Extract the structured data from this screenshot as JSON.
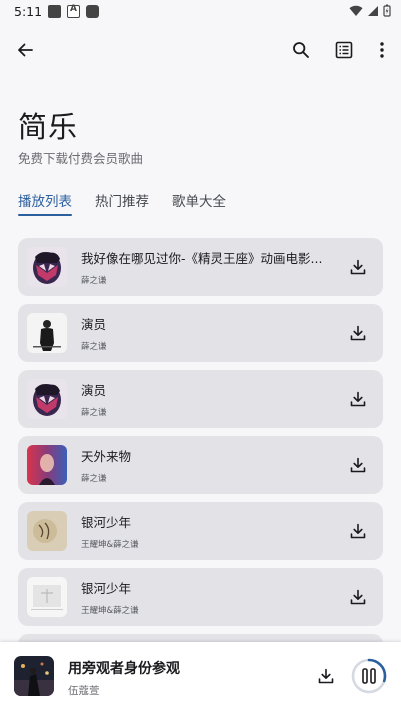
{
  "status_bar": {
    "time": "5:11"
  },
  "header": {
    "title": "简乐",
    "subtitle": "免费下载付费会员歌曲"
  },
  "tabs": [
    {
      "label": "播放列表",
      "active": true
    },
    {
      "label": "热门推荐",
      "active": false
    },
    {
      "label": "歌单大全",
      "active": false
    }
  ],
  "songs": [
    {
      "title": "我好像在哪见过你-《精灵王座》动画电影...",
      "artist": "薛之谦",
      "cover": "portrait-hands"
    },
    {
      "title": "演员",
      "artist": "薛之谦",
      "cover": "black-white-figure"
    },
    {
      "title": "演员",
      "artist": "薛之谦",
      "cover": "portrait-hands"
    },
    {
      "title": "天外来物",
      "artist": "薛之谦",
      "cover": "red-blue-portrait"
    },
    {
      "title": "银河少年",
      "artist": "王耀坤&薛之谦",
      "cover": "beige-sketch"
    },
    {
      "title": "银河少年",
      "artist": "王耀坤&薛之谦",
      "cover": "white-minimal"
    }
  ],
  "now_playing": {
    "title": "用旁观者身份参观",
    "artist": "伍蔻萱",
    "progress": 0.3,
    "state": "playing"
  },
  "colors": {
    "accent": "#2c5f9e",
    "card": "#e3e3e7",
    "background": "#f7f7f9"
  }
}
